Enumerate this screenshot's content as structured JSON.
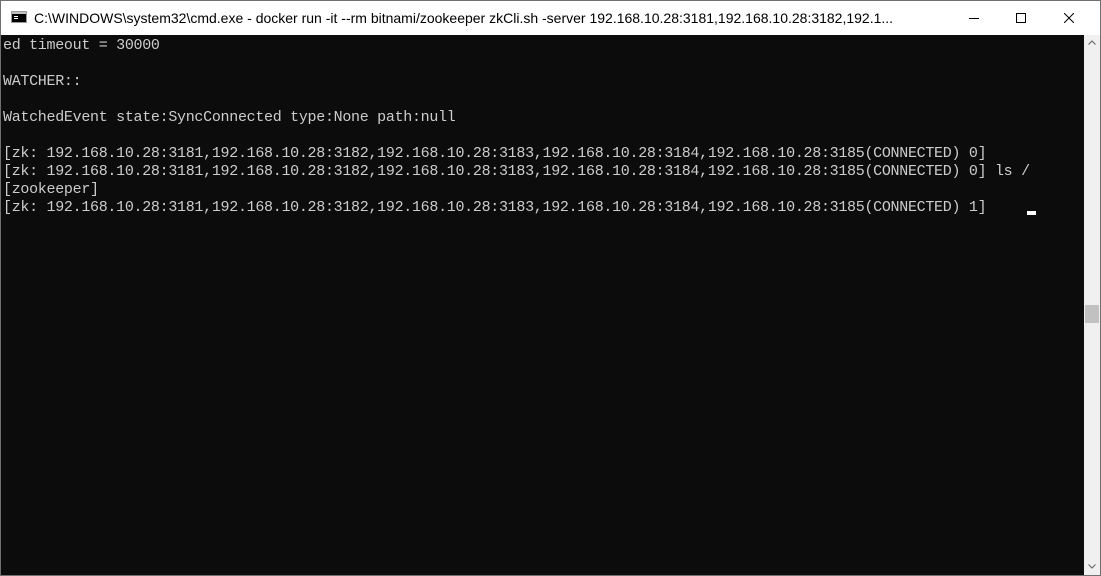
{
  "window": {
    "title": "C:\\WINDOWS\\system32\\cmd.exe - docker  run -it --rm  bitnami/zookeeper zkCli.sh -server 192.168.10.28:3181,192.168.10.28:3182,192.1...",
    "icon": "cmd-icon",
    "controls": {
      "minimize": "minimize-icon",
      "maximize": "maximize-icon",
      "close": "close-icon"
    }
  },
  "console": {
    "background": "#0c0c0c",
    "foreground": "#cccccc",
    "lines": [
      "ed timeout = 30000",
      "",
      "WATCHER::",
      "",
      "WatchedEvent state:SyncConnected type:None path:null",
      "",
      "[zk: 192.168.10.28:3181,192.168.10.28:3182,192.168.10.28:3183,192.168.10.28:3184,192.168.10.28:3185(CONNECTED) 0]",
      "[zk: 192.168.10.28:3181,192.168.10.28:3182,192.168.10.28:3183,192.168.10.28:3184,192.168.10.28:3185(CONNECTED) 0] ls /",
      "[zookeeper]",
      "[zk: 192.168.10.28:3181,192.168.10.28:3182,192.168.10.28:3183,192.168.10.28:3184,192.168.10.28:3185(CONNECTED) 1]"
    ]
  }
}
